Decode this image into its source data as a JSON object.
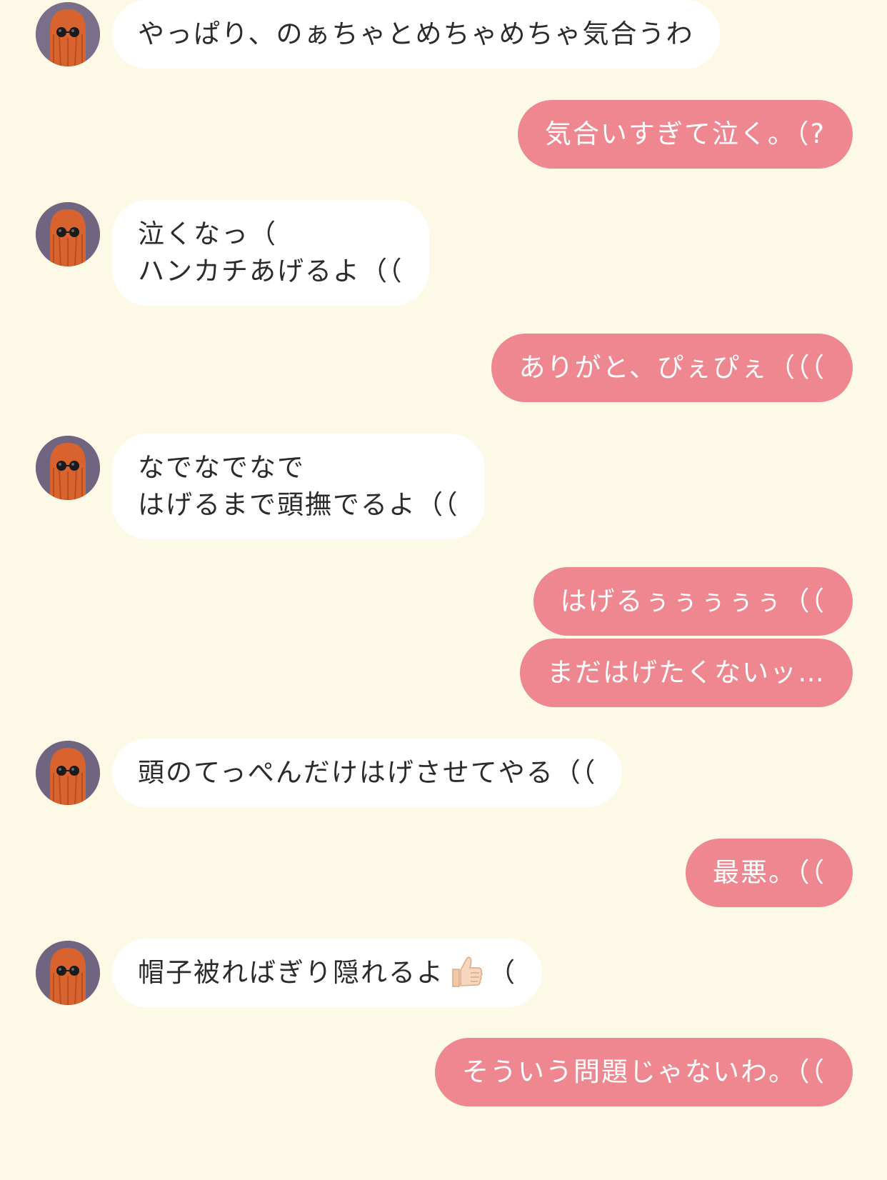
{
  "chat": {
    "colors": {
      "background": "#fdf9e7",
      "incoming_bubble": "#ffffff",
      "outgoing_bubble": "#ef8790",
      "incoming_text": "#2b2b2b",
      "outgoing_text": "#ffffff"
    },
    "avatar_icon": "ghost-with-sunglasses-avatar",
    "messages": [
      {
        "side": "left",
        "text": "やっぱり、のぁちゃとめちゃめちゃ気合うわ"
      },
      {
        "side": "right",
        "text": "気合いすぎて泣く。（?"
      },
      {
        "side": "left",
        "text": "泣くなっ（\nハンカチあげるよ（（"
      },
      {
        "side": "right",
        "text": "ありがと、ぴぇぴぇ（（（"
      },
      {
        "side": "left",
        "text": "なでなでなで\nはげるまで頭撫でるよ（（"
      },
      {
        "side": "right",
        "text": "はげるぅぅぅぅぅ（（"
      },
      {
        "side": "right",
        "text": "まだはげたくないッ…"
      },
      {
        "side": "left",
        "text": "頭のてっぺんだけはげさせてやる（（"
      },
      {
        "side": "right",
        "text": "最悪。（（"
      },
      {
        "side": "left",
        "text": "帽子被ればぎり隠れるよ",
        "suffix": "（",
        "emoji": "thumbs-up-icon"
      },
      {
        "side": "right",
        "text": "そういう問題じゃないわ。（（"
      }
    ]
  }
}
